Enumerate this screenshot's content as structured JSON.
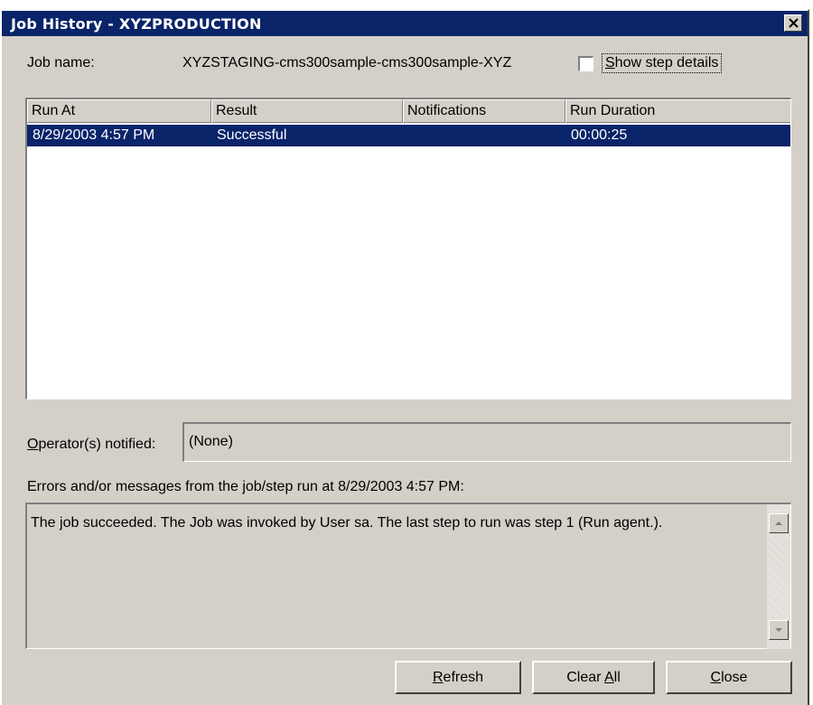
{
  "window": {
    "title": "Job History - XYZPRODUCTION"
  },
  "job": {
    "name_label": "Job name:",
    "name_value": "XYZSTAGING-cms300sample-cms300sample-XYZ",
    "show_step_details": {
      "checked": false,
      "prefix": "",
      "accel": "S",
      "rest": "how step details"
    }
  },
  "history": {
    "columns": [
      "Run At",
      "Result",
      "Notifications",
      "Run Duration"
    ],
    "rows": [
      {
        "run_at": "8/29/2003  4:57 PM",
        "result": "Successful",
        "notifications": "",
        "run_duration": "00:00:25",
        "selected": true
      }
    ]
  },
  "operators": {
    "label_accel": "O",
    "label_rest": "perator(s) notified:",
    "value": "(None)"
  },
  "messages": {
    "label": "Errors and/or messages from the job/step run at 8/29/2003  4:57 PM:",
    "text": "The job succeeded.  The Job was invoked by User sa.  The last step to run was step 1 (Run agent.)."
  },
  "buttons": {
    "refresh": {
      "accel": "R",
      "rest": "efresh"
    },
    "clear_all": {
      "prefix": "Clear ",
      "accel": "A",
      "rest": "ll"
    },
    "close": {
      "accel": "C",
      "rest": "lose"
    }
  },
  "colors": {
    "titlebar": "#0a246a",
    "selection": "#0a246a",
    "face": "#d4d0c8"
  }
}
